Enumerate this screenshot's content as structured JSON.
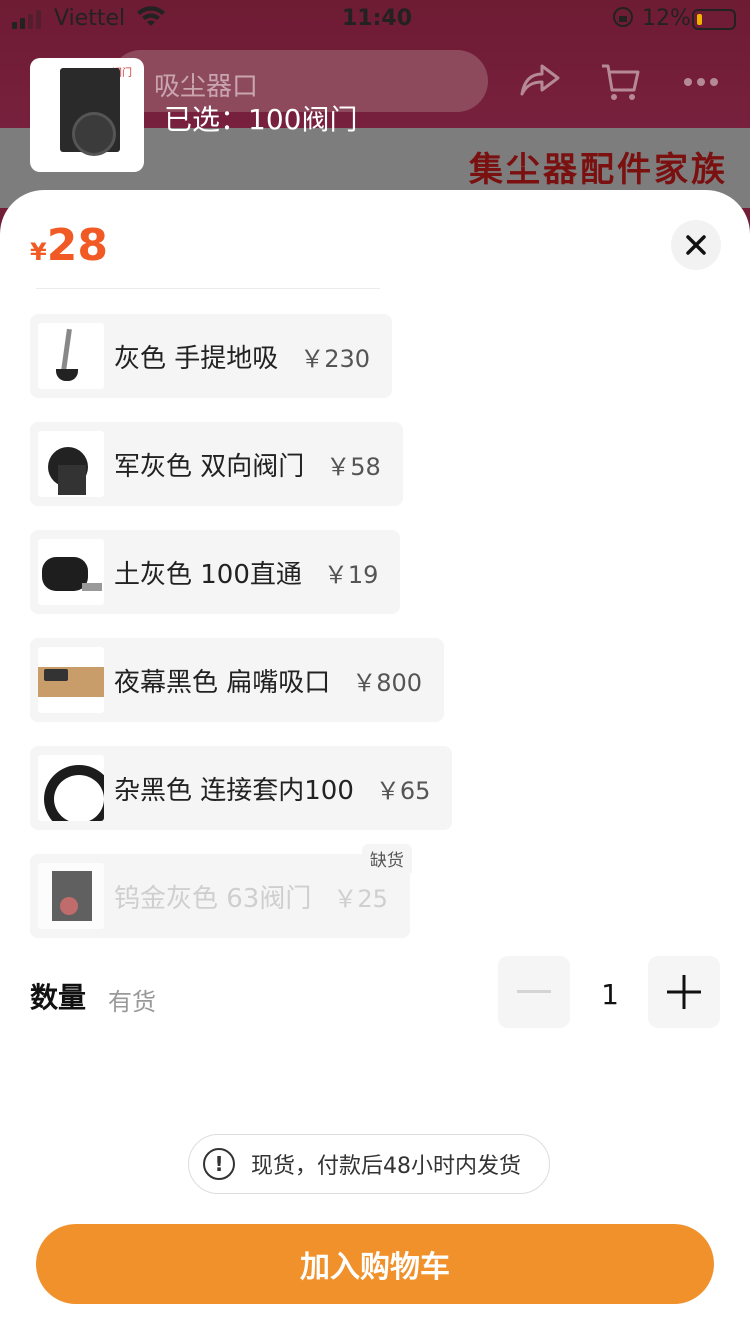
{
  "status_bar": {
    "carrier": "Viettel",
    "time": "11:40",
    "battery_percent": "12%"
  },
  "header": {
    "search_placeholder": "吸尘器口",
    "banner_text": "集尘器配件家族"
  },
  "product": {
    "thumb_label": "阀门",
    "selected_text": "已选：100阀门",
    "price_symbol": "¥",
    "price": "28"
  },
  "options": [
    {
      "name": "灰色 手提地吸",
      "price": "￥230",
      "available": true
    },
    {
      "name": "军灰色 双向阀门",
      "price": "￥58",
      "available": true
    },
    {
      "name": "土灰色 100直通",
      "price": "￥19",
      "available": true
    },
    {
      "name": "夜幕黑色 扁嘴吸口",
      "price": "￥800",
      "available": true
    },
    {
      "name": "杂黑色 连接套内100",
      "price": "￥65",
      "available": true
    },
    {
      "name": "钨金灰色 63阀门",
      "price": "￥25",
      "available": false,
      "tag": "缺货"
    }
  ],
  "quantity": {
    "label": "数量",
    "stock": "有货",
    "value": "1"
  },
  "notice": {
    "icon": "!",
    "text": "现货，付款后48小时内发货"
  },
  "add_to_cart": {
    "label": "加入购物车"
  },
  "colors": {
    "price": "#f15a24",
    "cta": "#f0912c"
  }
}
